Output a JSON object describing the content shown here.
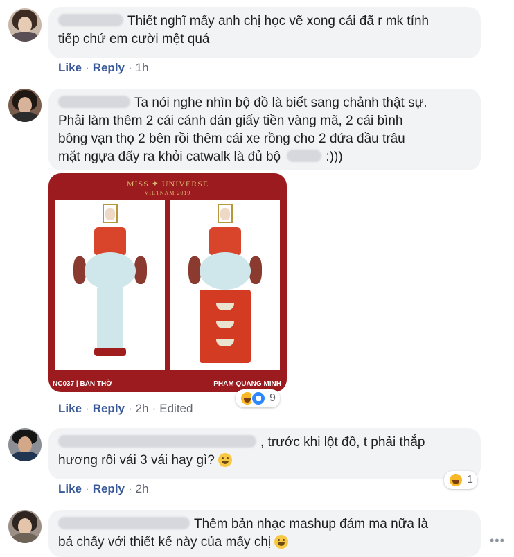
{
  "comments": [
    {
      "text_line1": "Thiết nghĩ mấy anh chị học vẽ xong cái đã r mk tính",
      "text_line2": "tiếp chứ em cười mệt quá",
      "like": "Like",
      "reply": "Reply",
      "time": "1h"
    },
    {
      "text_line1": "Ta nói nghe nhìn bộ đồ là biết sang chảnh thật sự.",
      "text_line2": "Phải làm thêm 2 cái cánh dán giấy tiền vàng mã, 2 cái bình",
      "text_line3": "bông vạn thọ 2 bên rồi thêm cái xe rồng cho 2 đứa đầu trâu",
      "text_line4": "mặt ngựa đẩy ra khỏi catwalk là đủ bộ",
      "text_line4_end": ":)))",
      "like": "Like",
      "reply": "Reply",
      "time": "2h",
      "edited": "Edited",
      "reaction_count": "9",
      "image": {
        "header_title": "MISS ✦ UNIVERSE",
        "header_subtitle": "VIETNAM 2019",
        "caption_left": "NC037 | BÀN THỜ",
        "caption_right": "PHẠM QUANG MINH"
      }
    },
    {
      "text_line1": ", trước khi lột đồ, t phải thắp",
      "text_line2": "hương rồi vái 3 vái hay gì?",
      "like": "Like",
      "reply": "Reply",
      "time": "2h",
      "reaction_count": "1"
    },
    {
      "text_line1": "Thêm bản nhạc mashup đám ma nữa là",
      "text_line2": "bá chấy với thiết kế này của mấy chị"
    }
  ],
  "icons": {
    "smile": "smile-emoji-icon",
    "sweat_smile": "sweat-smile-emoji-icon",
    "haha": "haha-reaction-icon",
    "like": "like-reaction-icon",
    "more": "more-options-icon"
  },
  "colors": {
    "link": "#385898",
    "bubble": "#f2f3f5",
    "poster_red": "#9b1b1f"
  }
}
